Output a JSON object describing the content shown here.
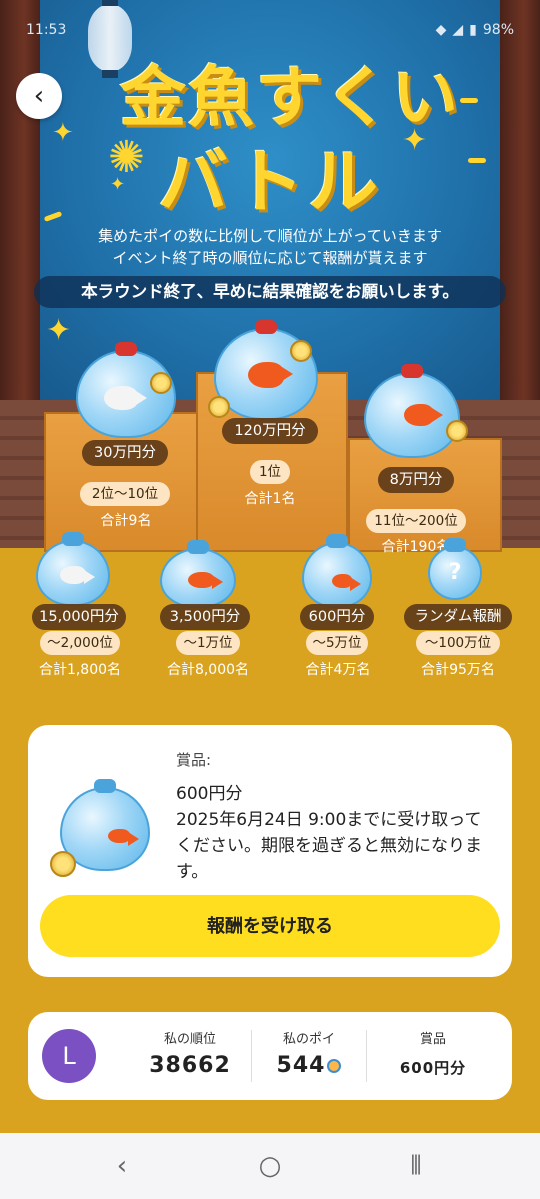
{
  "status_bar": {
    "time": "11:53",
    "battery": "98%"
  },
  "hero": {
    "title_line1": "金魚すくい",
    "title_line2": "バトル",
    "desc_line1": "集めたポイの数に比例して順位が上がっていきます",
    "desc_line2": "イベント終了時の順位に応じて報酬が貰えます",
    "notice": "本ラウンド終了、早めに結果確認をお願いします。"
  },
  "tiers_top": [
    {
      "prize": "120万円分",
      "rank": "1位",
      "count": "合計1名"
    },
    {
      "prize": "30万円分",
      "rank": "2位〜10位",
      "count": "合計9名"
    },
    {
      "prize": "8万円分",
      "rank": "11位〜200位",
      "count": "合計190名"
    }
  ],
  "tiers_bottom": [
    {
      "prize": "15,000円分",
      "rank": "〜2,000位",
      "count": "合計1,800名"
    },
    {
      "prize": "3,500円分",
      "rank": "〜1万位",
      "count": "合計8,000名"
    },
    {
      "prize": "600円分",
      "rank": "〜5万位",
      "count": "合計4万名"
    },
    {
      "prize": "ランダム報酬",
      "rank": "〜100万位",
      "count": "合計95万名"
    }
  ],
  "reward_card": {
    "label": "賞品:",
    "value": "600円分",
    "deadline": "2025年6月24日 9:00までに受け取ってください。期限を過ぎると無効になります。",
    "button": "報酬を受け取る"
  },
  "stats": {
    "avatar_initial": "L",
    "rank_label": "私の順位",
    "rank_value": "38662",
    "poi_label": "私のポイ",
    "poi_value": "544",
    "prize_label": "賞品",
    "prize_value": "600円分"
  },
  "icons": [
    "back-icon",
    "wifi-icon",
    "signal-icon",
    "battery-icon",
    "nav-back-icon",
    "nav-home-icon",
    "nav-recents-icon",
    "poi-icon"
  ],
  "colors": {
    "accent_yellow": "#fede1f",
    "page_gold": "#d9a31f",
    "avatar_purple": "#7b50c2",
    "sky_blue": "#1f6fa8"
  }
}
